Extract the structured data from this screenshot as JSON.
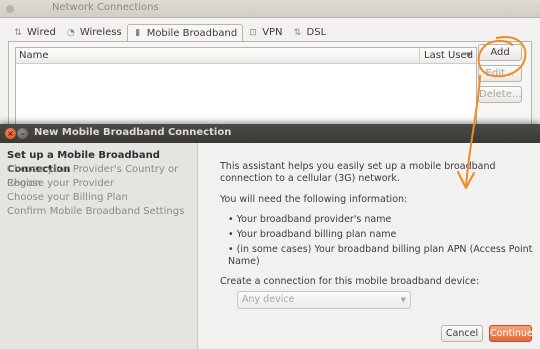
{
  "network_connections": {
    "title": "Network Connections",
    "tabs": [
      {
        "label": "Wired",
        "icon": "wired-icon"
      },
      {
        "label": "Wireless",
        "icon": "wireless-icon"
      },
      {
        "label": "Mobile Broadband",
        "icon": "mobile-broadband-icon",
        "active": true
      },
      {
        "label": "VPN",
        "icon": "vpn-icon"
      },
      {
        "label": "DSL",
        "icon": "dsl-icon"
      }
    ],
    "list_columns": {
      "name": "Name",
      "last_used": "Last Used"
    },
    "buttons": {
      "add": "Add",
      "edit": "Edit...",
      "delete": "Delete..."
    }
  },
  "assistant": {
    "title": "New Mobile Broadband Connection",
    "steps": [
      "Set up a Mobile Broadband Connection",
      "Choose your Provider's Country or Region",
      "Choose your Provider",
      "Choose your Billing Plan",
      "Confirm Mobile Broadband Settings"
    ],
    "intro": "This assistant helps you easily set up a mobile broadband connection to a cellular (3G) network.",
    "need_info": "You will need the following information:",
    "requirements": [
      "• Your broadband provider's name",
      "• Your broadband billing plan name",
      "• (in some cases) Your broadband billing plan APN (Access Point Name)"
    ],
    "device_label": "Create a connection for this mobile broadband device:",
    "device_selected": "Any device",
    "cancel": "Cancel",
    "continue": "Continue"
  },
  "colors": {
    "accent": "#dd4814",
    "annotation": "#f08a24",
    "titlebar_dark": "#3b3a36"
  }
}
